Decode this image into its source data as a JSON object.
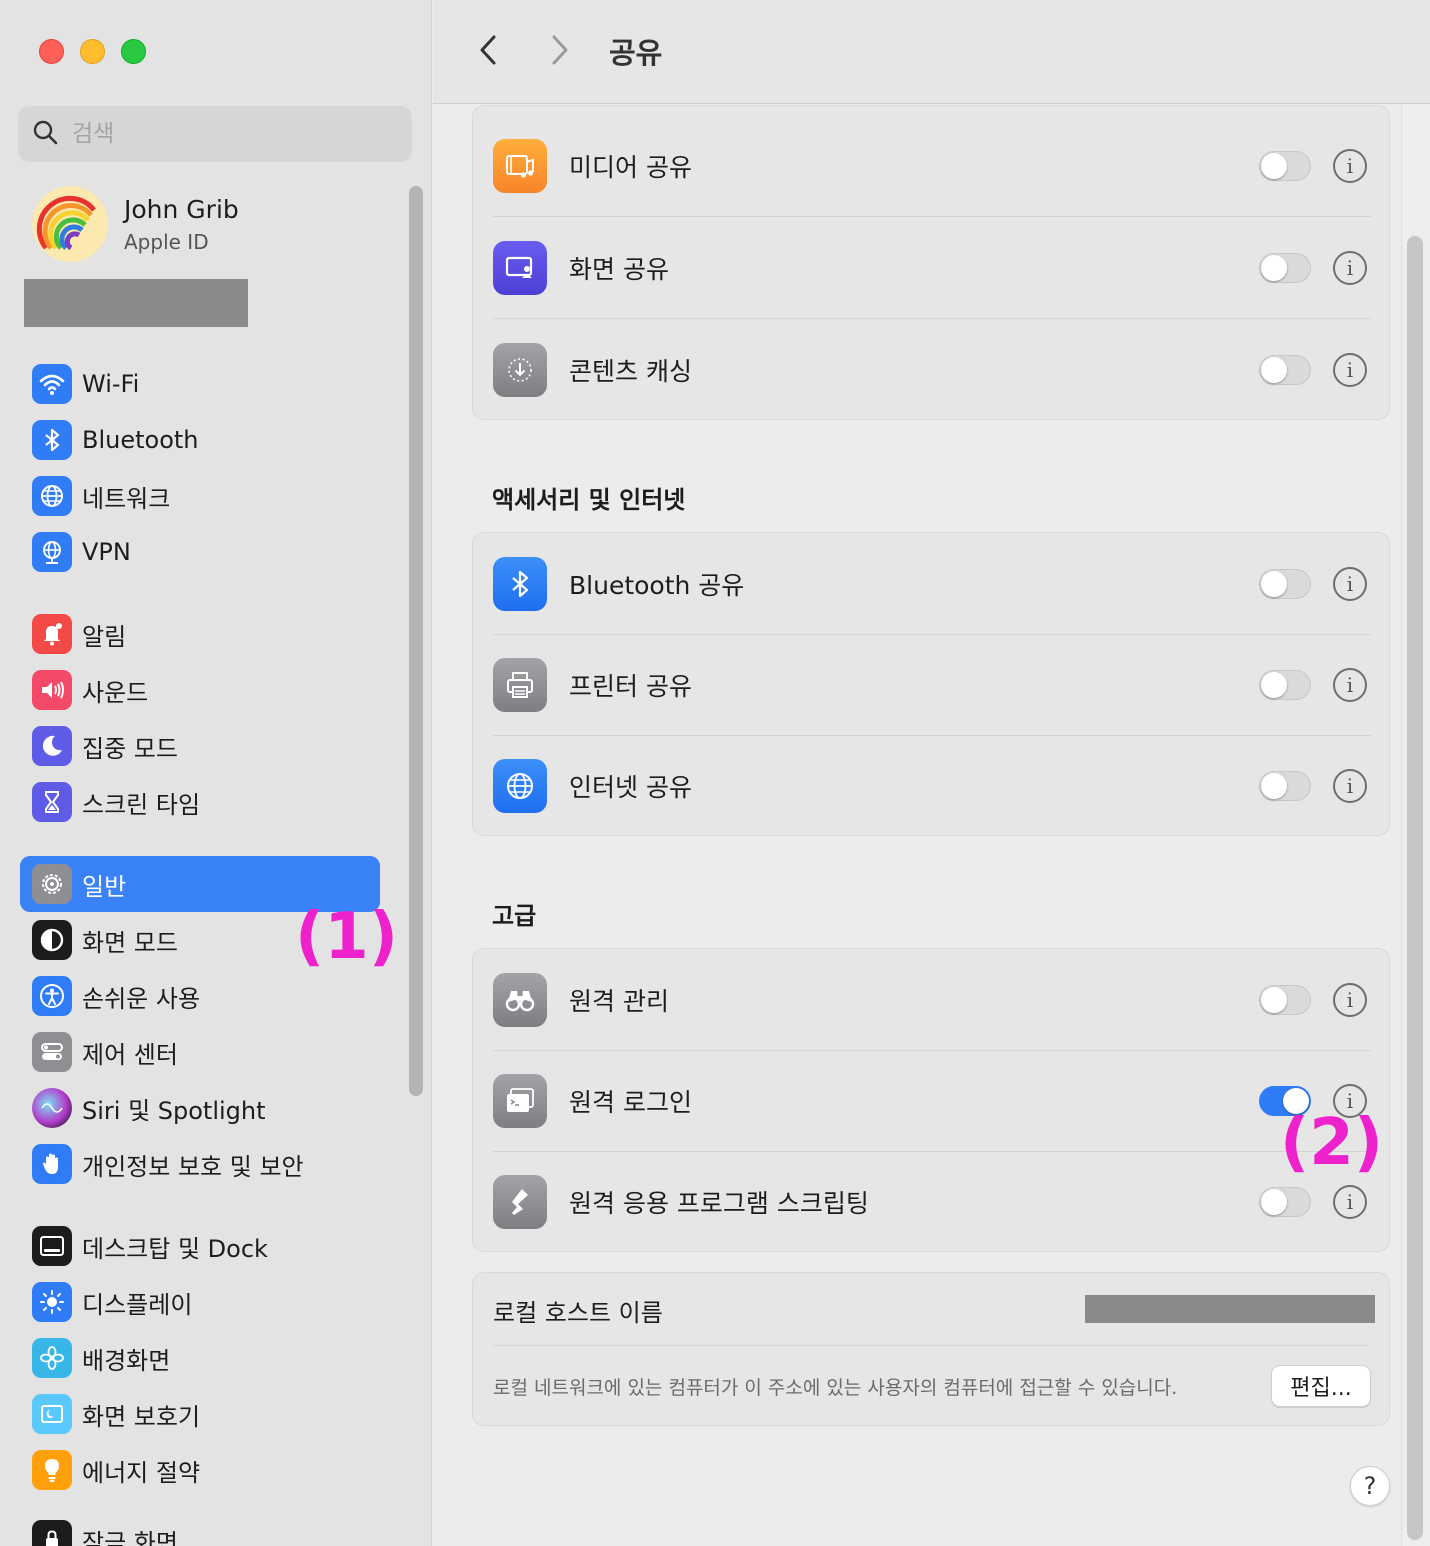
{
  "window": {
    "title": "공유"
  },
  "sidebar": {
    "search_placeholder": "검색",
    "profile": {
      "name": "John Grib",
      "subtitle": "Apple ID"
    },
    "items": [
      {
        "label": "Wi-Fi",
        "icon": "wifi-icon"
      },
      {
        "label": "Bluetooth",
        "icon": "bluetooth-icon"
      },
      {
        "label": "네트워크",
        "icon": "globe-icon"
      },
      {
        "label": "VPN",
        "icon": "vpn-globe-icon"
      },
      {
        "label": "알림",
        "icon": "bell-icon"
      },
      {
        "label": "사운드",
        "icon": "speaker-icon"
      },
      {
        "label": "집중 모드",
        "icon": "moon-icon"
      },
      {
        "label": "스크린 타임",
        "icon": "hourglass-icon"
      },
      {
        "label": "일반",
        "icon": "gear-icon",
        "selected": true
      },
      {
        "label": "화면 모드",
        "icon": "appearance-icon"
      },
      {
        "label": "손쉬운 사용",
        "icon": "accessibility-icon"
      },
      {
        "label": "제어 센터",
        "icon": "control-center-icon"
      },
      {
        "label": "Siri 및 Spotlight",
        "icon": "siri-icon"
      },
      {
        "label": "개인정보 보호 및 보안",
        "icon": "hand-icon"
      },
      {
        "label": "데스크탑 및 Dock",
        "icon": "dock-icon"
      },
      {
        "label": "디스플레이",
        "icon": "sun-icon"
      },
      {
        "label": "배경화면",
        "icon": "flower-icon"
      },
      {
        "label": "화면 보호기",
        "icon": "screensaver-icon"
      },
      {
        "label": "에너지 절약",
        "icon": "lightbulb-icon"
      },
      {
        "label": "잠금 화면",
        "icon": "lock-icon"
      }
    ]
  },
  "annotations": {
    "first": "(1)",
    "second": "(2)"
  },
  "groups": {
    "content": [
      {
        "label": "미디어 공유",
        "icon": "media-sharing-icon",
        "on": false
      },
      {
        "label": "화면 공유",
        "icon": "screen-sharing-icon",
        "on": false
      },
      {
        "label": "콘텐츠 캐싱",
        "icon": "content-caching-icon",
        "on": false
      }
    ],
    "accessories_title": "액세서리 및 인터넷",
    "accessories": [
      {
        "label": "Bluetooth 공유",
        "icon": "bluetooth-sharing-icon",
        "on": false
      },
      {
        "label": "프린터 공유",
        "icon": "printer-icon",
        "on": false
      },
      {
        "label": "인터넷 공유",
        "icon": "internet-sharing-icon",
        "on": false
      }
    ],
    "advanced_title": "고급",
    "advanced": [
      {
        "label": "원격 관리",
        "icon": "binoculars-icon",
        "on": false
      },
      {
        "label": "원격 로그인",
        "icon": "terminal-icon",
        "on": true
      },
      {
        "label": "원격 응용 프로그램 스크립팅",
        "icon": "script-icon",
        "on": false
      }
    ]
  },
  "hostname": {
    "label": "로컬 호스트 이름",
    "description": "로컬 네트워크에 있는 컴퓨터가 이 주소에 있는 사용자의 컴퓨터에 접근할 수 있습니다.",
    "edit_label": "편집...",
    "help_label": "?"
  },
  "colors": {
    "accent": "#3a82f7",
    "annotation": "#ee22cc"
  }
}
